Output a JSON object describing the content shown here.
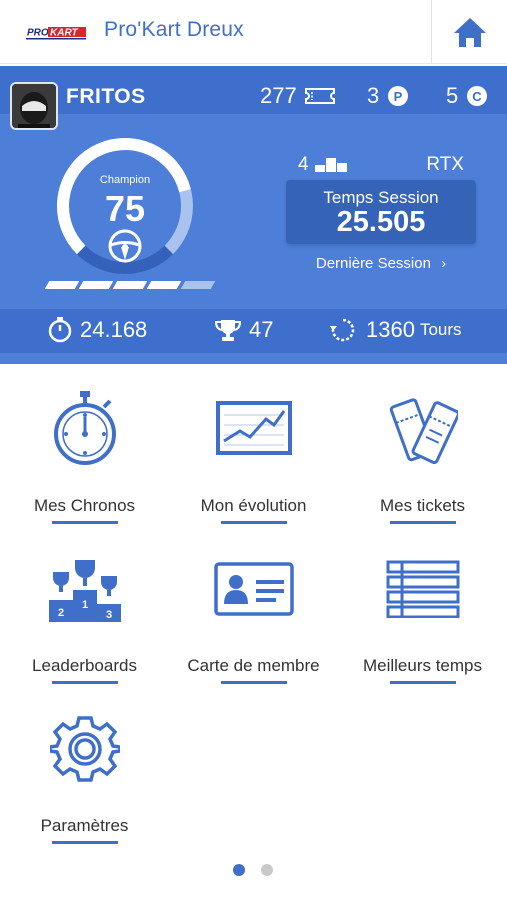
{
  "header": {
    "title": "Pro'Kart Dreux",
    "logo_text": "PROKART",
    "home_icon": "home-icon"
  },
  "profile": {
    "username": "FRITOS",
    "tickets": "277",
    "points": "3",
    "credits": "5",
    "level_label": "Champion",
    "level_value": "75",
    "level_progress": 0.78,
    "rank": "4",
    "kart": "RTX",
    "session_title": "Temps Session",
    "session_time": "25.505",
    "last_session_label": "Dernière Session",
    "progress_segments_filled": 4,
    "progress_segments_total": 5
  },
  "stats": {
    "best_time": "24.168",
    "trophies": "47",
    "laps": "1360",
    "laps_unit": "Tours"
  },
  "menu": [
    {
      "label": "Mes Chronos",
      "icon": "stopwatch-icon"
    },
    {
      "label": "Mon évolution",
      "icon": "chart-icon"
    },
    {
      "label": "Mes tickets",
      "icon": "tickets-icon"
    },
    {
      "label": "Leaderboards",
      "icon": "podium-icon"
    },
    {
      "label": "Carte de membre",
      "icon": "member-card-icon"
    },
    {
      "label": "Meilleurs temps",
      "icon": "list-icon"
    },
    {
      "label": "Paramètres",
      "icon": "gear-icon"
    }
  ],
  "pagination": {
    "current": 1,
    "total": 2
  },
  "colors": {
    "primary": "#4d7fd8",
    "dark": "#3e6fcc",
    "accent": "#3f6fc9"
  }
}
